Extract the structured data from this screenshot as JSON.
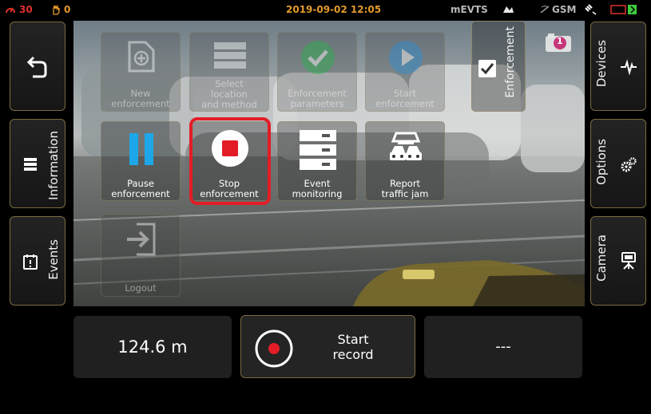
{
  "status_bar": {
    "speed_value": "30",
    "hand_value": "0",
    "datetime": "2019-09-02 12:05",
    "mode": "mEVTS",
    "network": "GSM"
  },
  "left_panel": {
    "back_icon": "back-arrow-icon",
    "information_label": "Information",
    "events_label": "Events"
  },
  "right_panel": {
    "devices_label": "Devices",
    "options_label": "Options",
    "camera_label": "Camera"
  },
  "enforcement_tab": {
    "label": "Enforcement",
    "checked": true
  },
  "camera_badge": "1",
  "tiles": [
    {
      "line1": "New",
      "line2": "enforcement",
      "line3": "",
      "icon": "plus-document-icon",
      "enabled": false
    },
    {
      "line1": "Select",
      "line2": "location",
      "line3": "and method",
      "icon": "list-icon",
      "enabled": false
    },
    {
      "line1": "Enforcement",
      "line2": "parameters",
      "line3": "",
      "icon": "check-circle-icon",
      "enabled": false
    },
    {
      "line1": "Start",
      "line2": "enforcement",
      "line3": "",
      "icon": "play-circle-icon",
      "enabled": false
    },
    {
      "line1": "Pause",
      "line2": "enforcement",
      "line3": "",
      "icon": "pause-icon",
      "enabled": true
    },
    {
      "line1": "Stop",
      "line2": "enforcement",
      "line3": "",
      "icon": "stop-circle-icon",
      "enabled": true
    },
    {
      "line1": "Event",
      "line2": "monitoring",
      "line3": "",
      "icon": "server-stack-icon",
      "enabled": true
    },
    {
      "line1": "Report",
      "line2": "traffic jam",
      "line3": "",
      "icon": "cars-icon",
      "enabled": true
    },
    {
      "line1": "Logout",
      "line2": "",
      "line3": "",
      "icon": "logout-icon",
      "enabled": false
    }
  ],
  "bottom": {
    "distance": "124.6 m",
    "record_line1": "Start",
    "record_line2": "record",
    "third": "---"
  },
  "colors": {
    "accent_border": "#7a6a3e",
    "stop_highlight": "#e21d26",
    "pause_blue": "#1ea7e8",
    "check_green": "#27b24a",
    "play_blue": "#2a8fd6"
  }
}
